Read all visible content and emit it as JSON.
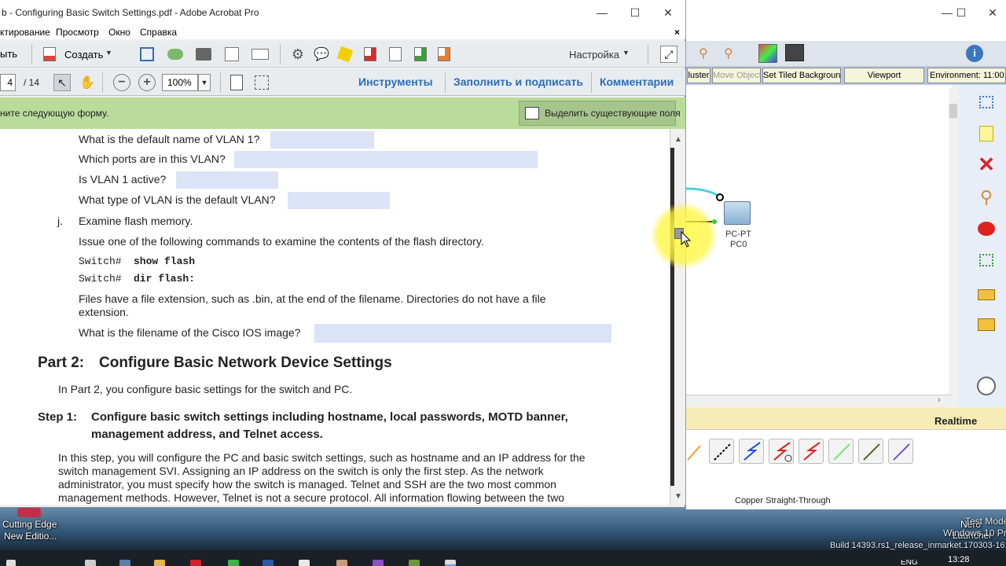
{
  "desktop": {
    "icon_cutting_edge_line1": "Cutting Edge",
    "icon_cutting_edge_line2": "New Editio...",
    "nero_line1": "Nero",
    "nero_line2": "Launcher",
    "watermark_line1": "Test Mode",
    "watermark_line2": "Windows 10 Pro",
    "watermark_line3": "Build 14393.rs1_release_inmarket.170303-1614",
    "tray_lang": "ENG",
    "tray_time": "13:28"
  },
  "packet_tracer": {
    "buttons": [
      "luster",
      "Move Object",
      "Set Tiled Background",
      "Viewport",
      "Environment: 11:00:0"
    ],
    "device_label_type": "PC-PT",
    "device_label_name": "PC0",
    "realtime_label": "Realtime",
    "connection_label": "Copper Straight-Through"
  },
  "acrobat": {
    "window_title": "b - Configuring Basic Switch Settings.pdf - Adobe Acrobat Pro",
    "menu": [
      "ктирование",
      "Просмотр",
      "Окно",
      "Справка"
    ],
    "toolbar": {
      "open_label": "ыть",
      "create_label": "Создать",
      "customize_label": "Настройка"
    },
    "nav": {
      "page_current": "4",
      "page_total": "/ 14",
      "zoom": "100%",
      "tools": "Инструменты",
      "fill_sign": "Заполнить и подписать",
      "comments": "Комментарии"
    },
    "form_bar": {
      "message": "ните следующую форму.",
      "highlight_button": "Выделить существующие поля"
    },
    "document": {
      "q1": "What is the default name of VLAN 1?",
      "q2": "Which ports are in this VLAN?",
      "q3": "Is VLAN 1 active?",
      "q4": "What type of VLAN is the default VLAN?",
      "step_j_letter": "j.",
      "step_j_text": "Examine flash memory.",
      "issue_text": "Issue one of the following commands to examine the contents of the flash directory.",
      "cmd1_prompt": "Switch#",
      "cmd1": "show flash",
      "cmd2_prompt": "Switch#",
      "cmd2": "dir flash:",
      "files_text": "Files have a file extension, such as .bin, at the end of the filename. Directories do not have a file extension.",
      "q5": "What is the filename of the Cisco IOS image?",
      "part2_num": "Part 2:",
      "part2_title": "Configure Basic Network Device Settings",
      "part2_intro": "In Part 2, you configure basic settings for the switch and PC.",
      "step1_num": "Step 1:",
      "step1_line1": "Configure basic switch settings including hostname, local passwords, MOTD banner,",
      "step1_line2": "management address, and Telnet access.",
      "step1_para": "In this step, you will configure the PC and basic switch settings, such as hostname and an IP address for the switch management SVI. Assigning an IP address on the switch is only the first step. As the network administrator, you must specify how the switch is managed. Telnet and SSH are the two most common management methods. However, Telnet is not a secure protocol. All information flowing between the two"
    }
  },
  "colors": {
    "form_bar": "#b9dc9b",
    "field_fill": "#dde3f7",
    "halo": "#fff44f",
    "link_blue": "#2a6ebb"
  }
}
